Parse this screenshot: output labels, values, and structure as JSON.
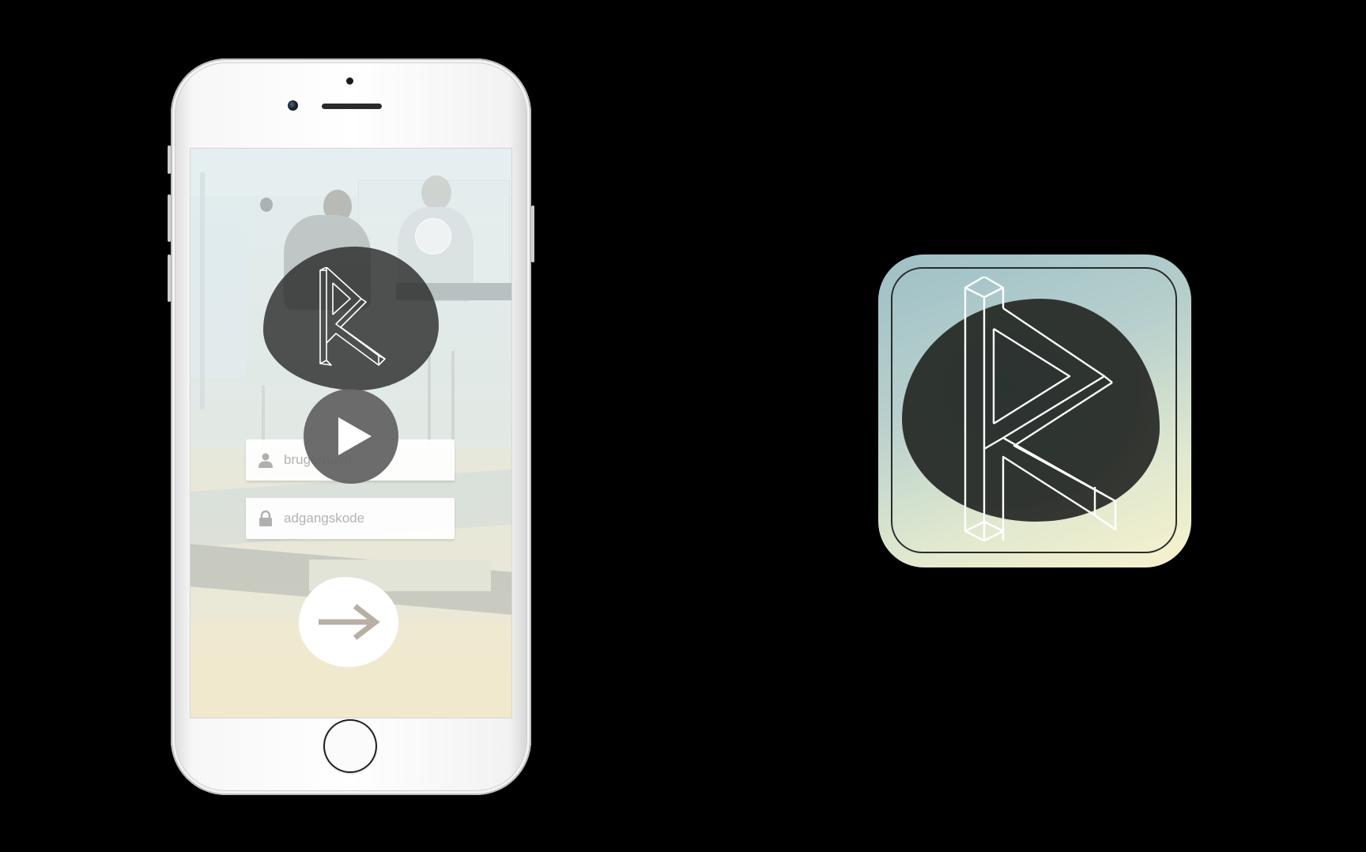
{
  "login": {
    "username_placeholder": "brugernavn",
    "password_placeholder": "adgangskode"
  },
  "icons": {
    "logo": "r-logo-icon",
    "play": "play-icon",
    "submit": "arrow-right-icon",
    "username": "user-icon",
    "password": "lock-icon"
  },
  "colors": {
    "background": "#000000",
    "blob": "#2e3330",
    "play_button": "#5f5f5f",
    "icon_gradient_start": "#9ec0c6",
    "icon_gradient_end": "#f8f2cd"
  }
}
